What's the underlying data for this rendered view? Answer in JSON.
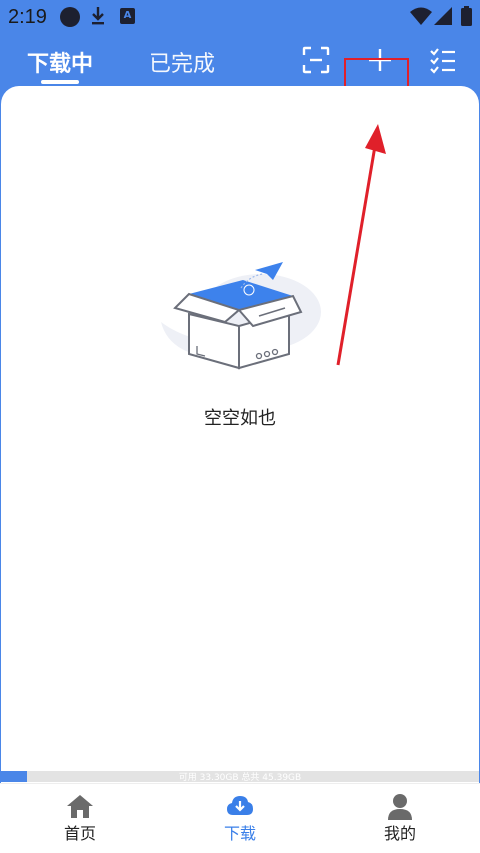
{
  "status_bar": {
    "time": "2:19",
    "icons": [
      "notification-dot-icon",
      "download-icon",
      "text-a-icon",
      "wifi-icon",
      "signal-icon",
      "battery-icon"
    ]
  },
  "header": {
    "tabs": [
      {
        "label": "下载中",
        "active": true
      },
      {
        "label": "已完成",
        "active": false
      }
    ],
    "actions": [
      "scan-icon",
      "add-icon",
      "checklist-icon"
    ]
  },
  "main": {
    "empty_text": "空空如也"
  },
  "storage": {
    "text": "可用 33.30GB 总共 45.39GB",
    "used_fraction": 0.055
  },
  "bottom_nav": {
    "items": [
      {
        "label": "首页",
        "icon": "home-icon",
        "active": false
      },
      {
        "label": "下载",
        "icon": "cloud-download-icon",
        "active": true
      },
      {
        "label": "我的",
        "icon": "user-icon",
        "active": false
      }
    ]
  },
  "colors": {
    "primary": "#4a86e8",
    "annotation": "#e0202a",
    "active_nav": "#3a7fe8",
    "inactive_icon": "#8a8a8a"
  }
}
